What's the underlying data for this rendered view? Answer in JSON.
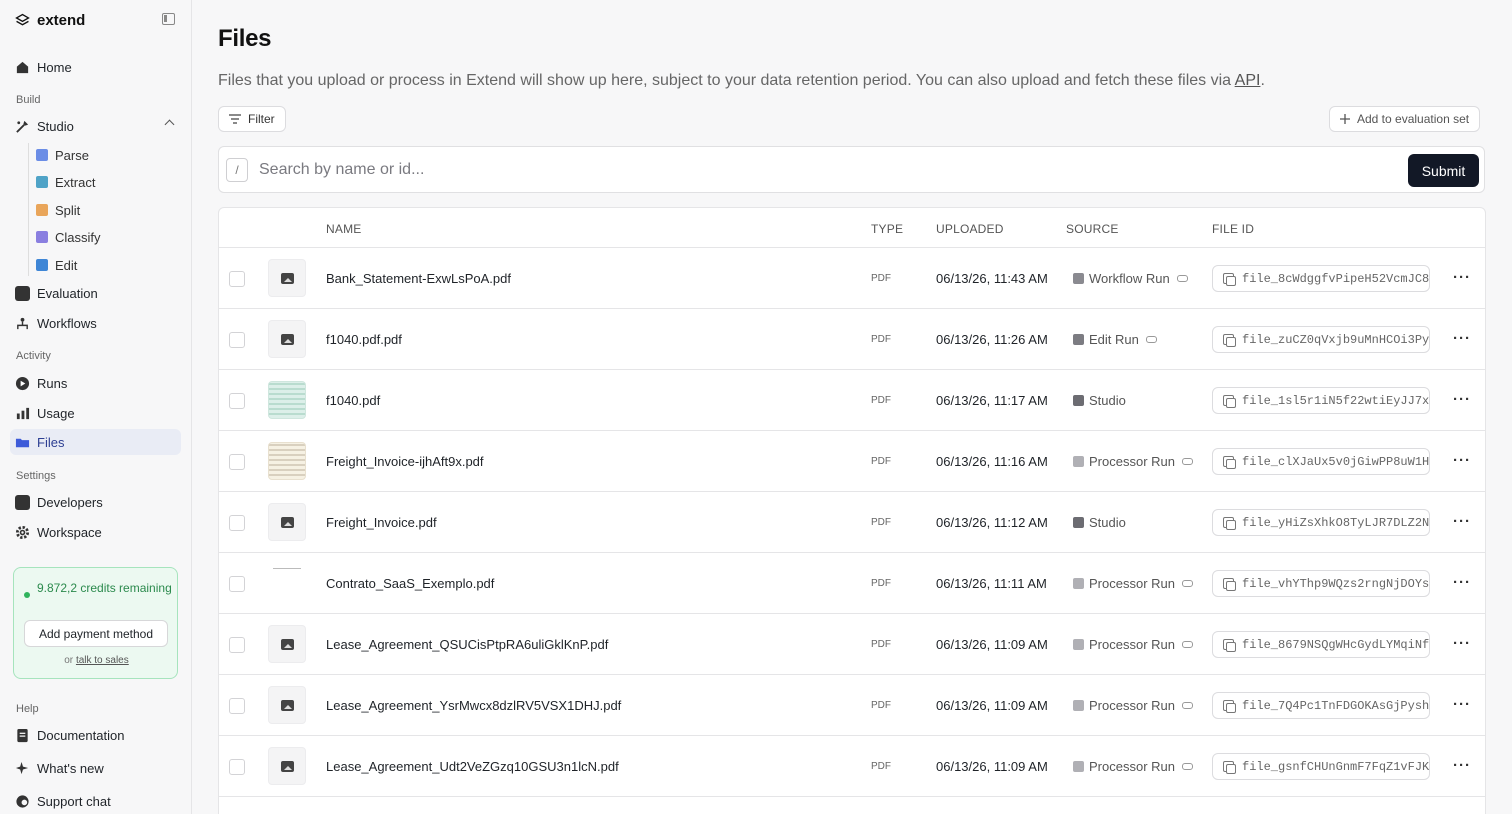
{
  "brand": {
    "name": "extend"
  },
  "sidebar": {
    "home": "Home",
    "build_label": "Build",
    "studio": "Studio",
    "studio_items": [
      "Parse",
      "Extract",
      "Split",
      "Classify",
      "Edit"
    ],
    "evaluation": "Evaluation",
    "workflows": "Workflows",
    "activity_label": "Activity",
    "runs": "Runs",
    "usage": "Usage",
    "files": "Files",
    "settings_label": "Settings",
    "developers": "Developers",
    "workspace": "Workspace",
    "credits_text": "9.872,2 credits remaining",
    "add_payment": "Add payment method",
    "or": "or",
    "talk_to_sales": "talk to sales",
    "help_label": "Help",
    "documentation": "Documentation",
    "whats_new": "What's new",
    "support_chat": "Support chat"
  },
  "main": {
    "title": "Files",
    "description": "Files that you upload or process in Extend will show up here, subject to your data retention period. You can also upload and fetch these files via",
    "api_link": "API",
    "description_end": ".",
    "filter": "Filter",
    "add_to_eval": "Add to evaluation set",
    "search_shortcut": "/",
    "search_placeholder": "Search by name or id...",
    "submit": "Submit"
  },
  "table": {
    "headers": {
      "name": "NAME",
      "type": "TYPE",
      "uploaded": "UPLOADED",
      "source": "SOURCE",
      "file_id": "FILE ID"
    },
    "rows": [
      {
        "name": "Bank_Statement-ExwLsPoA.pdf",
        "type": "PDF",
        "uploaded": "06/13/26, 11:43 AM",
        "source": "Workflow Run",
        "file_id": "file_8cWdggfvPipeH52VcmJC8"
      },
      {
        "name": "f1040.pdf.pdf",
        "type": "PDF",
        "uploaded": "06/13/26, 11:26 AM",
        "source": "Edit Run",
        "file_id": "file_zuCZ0qVxjb9uMnHCOi3Py"
      },
      {
        "name": "f1040.pdf",
        "type": "PDF",
        "uploaded": "06/13/26, 11:17 AM",
        "source": "Studio",
        "file_id": "file_1sl5r1iN5f22wtiEyJJ7x"
      },
      {
        "name": "Freight_Invoice-ijhAft9x.pdf",
        "type": "PDF",
        "uploaded": "06/13/26, 11:16 AM",
        "source": "Processor Run",
        "file_id": "file_clXJaUx5v0jGiwPP8uW1H"
      },
      {
        "name": "Freight_Invoice.pdf",
        "type": "PDF",
        "uploaded": "06/13/26, 11:12 AM",
        "source": "Studio",
        "file_id": "file_yHiZsXhkO8TyLJR7DLZ2N"
      },
      {
        "name": "Contrato_SaaS_Exemplo.pdf",
        "type": "PDF",
        "uploaded": "06/13/26, 11:11 AM",
        "source": "Processor Run",
        "file_id": "file_vhYThp9WQzs2rngNjDOYs"
      },
      {
        "name": "Lease_Agreement_QSUCisPtpRA6uliGklKnP.pdf",
        "type": "PDF",
        "uploaded": "06/13/26, 11:09 AM",
        "source": "Processor Run",
        "file_id": "file_8679NSQgWHcGydLYMqiNf"
      },
      {
        "name": "Lease_Agreement_YsrMwcx8dzlRV5VSX1DHJ.pdf",
        "type": "PDF",
        "uploaded": "06/13/26, 11:09 AM",
        "source": "Processor Run",
        "file_id": "file_7Q4Pc1TnFDGOKAsGjPysh"
      },
      {
        "name": "Lease_Agreement_Udt2VeZGzq10GSU3n1lcN.pdf",
        "type": "PDF",
        "uploaded": "06/13/26, 11:09 AM",
        "source": "Processor Run",
        "file_id": "file_gsnfCHUnGnmF7FqZ1vFJK"
      }
    ]
  },
  "colors": {
    "accent": "#121826",
    "active_nav": "#e9ecf5",
    "credits_green": "#2b8a4d"
  }
}
